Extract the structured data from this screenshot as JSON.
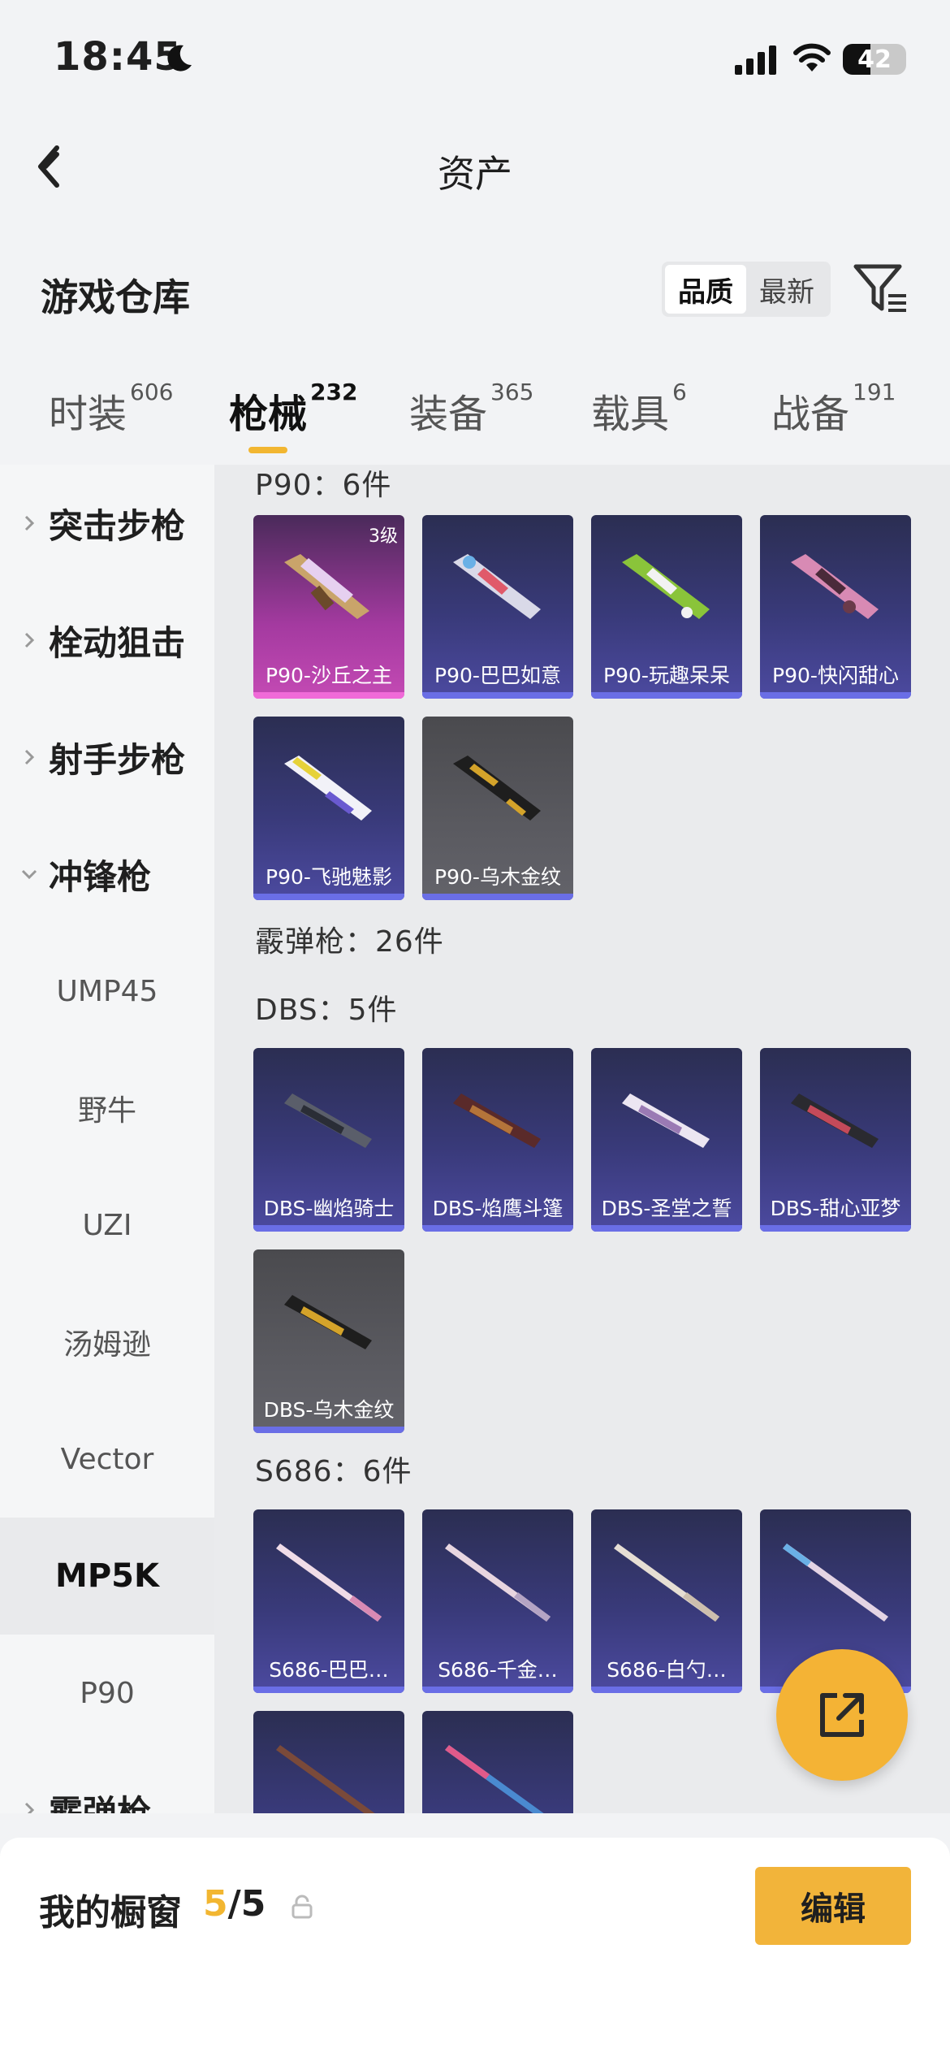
{
  "status": {
    "time": "18:45",
    "battery": "42"
  },
  "nav": {
    "title": "资产"
  },
  "header": {
    "section_title": "游戏仓库",
    "sort_options": [
      "品质",
      "最新"
    ]
  },
  "tabs": [
    {
      "label": "时装",
      "count": "606"
    },
    {
      "label": "枪械",
      "count": "232"
    },
    {
      "label": "装备",
      "count": "365"
    },
    {
      "label": "载具",
      "count": "6"
    },
    {
      "label": "战备",
      "count": "191"
    }
  ],
  "sidebar": {
    "items": [
      {
        "label": "突击步枪"
      },
      {
        "label": "栓动狙击"
      },
      {
        "label": "射手步枪"
      },
      {
        "label": "冲锋枪"
      },
      {
        "label": "UMP45"
      },
      {
        "label": "野牛"
      },
      {
        "label": "UZI"
      },
      {
        "label": "汤姆逊"
      },
      {
        "label": "Vector"
      },
      {
        "label": "MP5K"
      },
      {
        "label": "P90"
      },
      {
        "label": "霰弹枪"
      }
    ]
  },
  "content": {
    "p90_header": "P90：6件",
    "p90_items": [
      {
        "name": "P90-沙丘之主",
        "level": "3级"
      },
      {
        "name": "P90-巴巴如意"
      },
      {
        "name": "P90-玩趣呆呆"
      },
      {
        "name": "P90-快闪甜心"
      },
      {
        "name": "P90-飞驰魅影"
      },
      {
        "name": "P90-乌木金纹"
      }
    ],
    "shotgun_header": "霰弹枪：26件",
    "dbs_header": "DBS：5件",
    "dbs_items": [
      {
        "name": "DBS-幽焰骑士"
      },
      {
        "name": "DBS-焰鹰斗篷"
      },
      {
        "name": "DBS-圣堂之誓"
      },
      {
        "name": "DBS-甜心亚梦"
      },
      {
        "name": "DBS-乌木金纹"
      }
    ],
    "s686_header": "S686：6件",
    "s686_items": [
      {
        "name": "S686-巴巴…"
      },
      {
        "name": "S686-千金…"
      },
      {
        "name": "S686-白勺…"
      },
      {
        "name": "S6"
      }
    ]
  },
  "bottom": {
    "label": "我的橱窗",
    "count_current": "5",
    "count_total": "/5",
    "edit_label": "编辑"
  },
  "colors": {
    "accent": "#f2b631",
    "card_bar": "#6a6ee6"
  }
}
